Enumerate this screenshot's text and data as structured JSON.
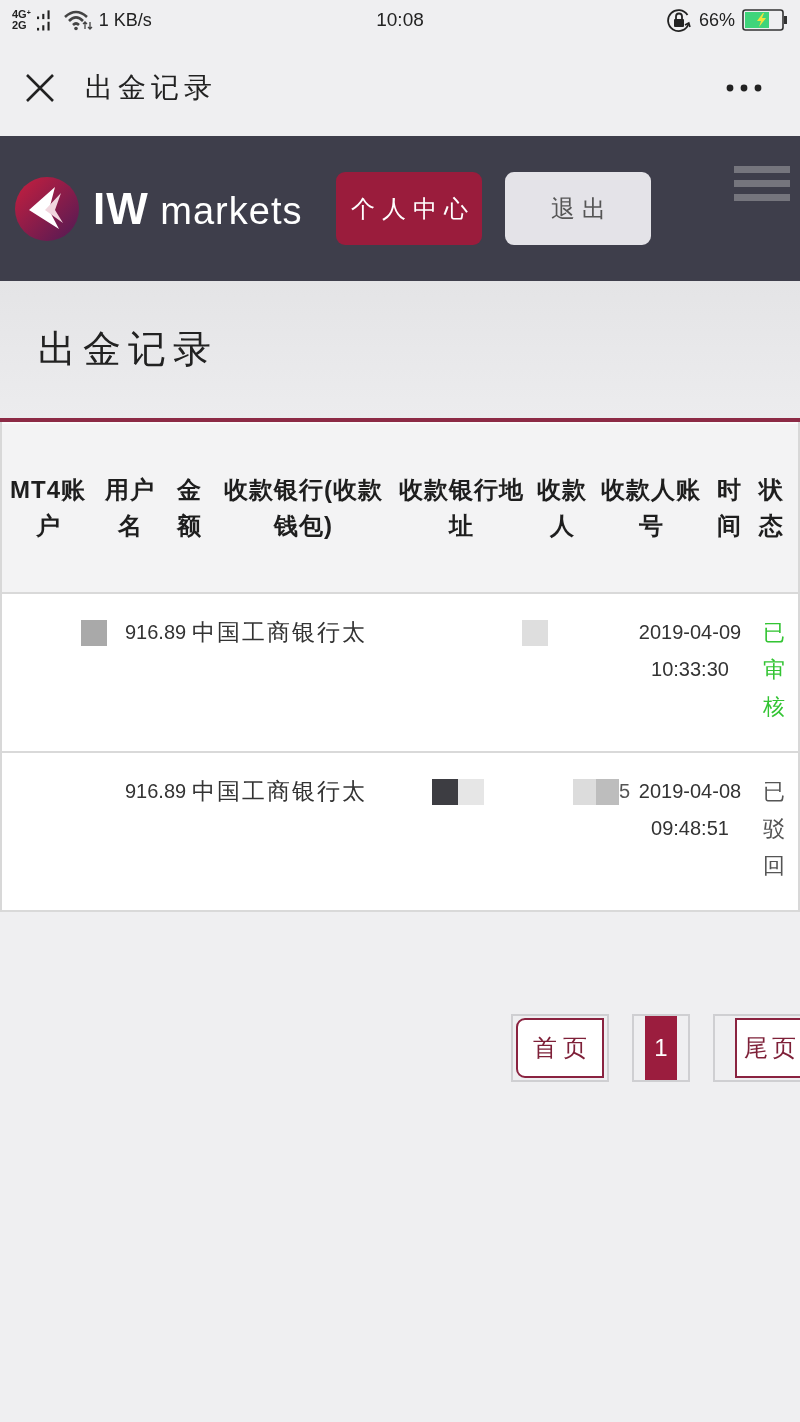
{
  "status_bar": {
    "network": [
      "4G$^{+}$",
      "2G"
    ],
    "speed": "1 KB/s",
    "time": "10:08",
    "battery": "66%"
  },
  "nav_bar": {
    "title": "出金记录"
  },
  "site_header": {
    "brand": "**IW** markets",
    "buttons": [
      {
        "label": "个人中心",
        "kind": "primary"
      },
      {
        "label": "退出",
        "kind": "secondary"
      }
    ]
  },
  "page_title": "出金记录",
  "table": {
    "columns": [
      "MT4账户",
      "用户名",
      "金额",
      "收款银行(收款钱包)",
      "收款银行地址",
      "收款人",
      "收款人账号",
      "时间",
      "状态"
    ],
    "rows": [
      {
        "username_mask": [
          {
            "color": "#a9a9a9"
          }
        ],
        "amount": "916.89",
        "bank": "中国工商银行太",
        "payee_mask": [
          {
            "color": "#dedede"
          }
        ],
        "time": "2019-04-09 10:33:30",
        "status": "已审核",
        "color": "#33c433"
      },
      {
        "amount": "916.89",
        "bank": "中国工商银行太",
        "address_mask": [
          {
            "color": "#3d3d42"
          },
          {
            "color": "#e6e6e6"
          }
        ],
        "account_mask": [
          {
            "color": "#dcdcdc"
          },
          {
            "color": "#bdbdbd"
          }
        ],
        "payee_account": "5",
        "time": "2019-04-08 09:48:51",
        "status": "已驳回",
        "color": "#555555"
      }
    ]
  },
  "pagination": {
    "first": "首页",
    "pages": [
      {
        "label": "1",
        "selected": true
      }
    ],
    "last": "尾页"
  }
}
